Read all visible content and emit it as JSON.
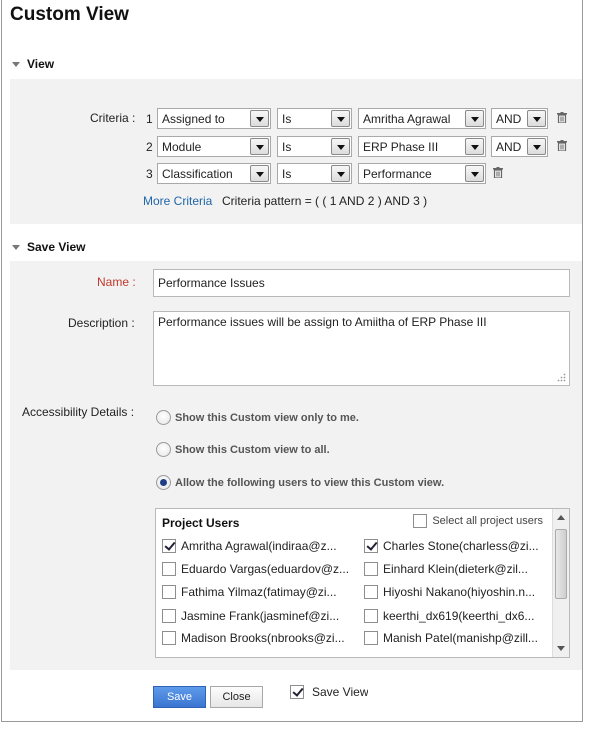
{
  "title": "Custom View",
  "view_section": {
    "heading": "View",
    "criteria_label": "Criteria :",
    "rows": [
      {
        "num": "1",
        "field": "Assigned to",
        "op": "Is",
        "value": "Amritha Agrawal",
        "conj": "AND"
      },
      {
        "num": "2",
        "field": "Module",
        "op": "Is",
        "value": "ERP Phase III",
        "conj": "AND"
      },
      {
        "num": "3",
        "field": "Classification",
        "op": "Is",
        "value": "Performance"
      }
    ],
    "more_criteria": "More Criteria",
    "pattern": "Criteria pattern = ( ( 1 AND 2 ) AND 3 )"
  },
  "save_section": {
    "heading": "Save View",
    "name_label": "Name :",
    "name_value": "Performance Issues",
    "description_label": "Description :",
    "description_value": "Performance issues will be assign to Amiitha of ERP Phase III",
    "access_label": "Accessibility Details :",
    "options": [
      "Show this Custom view only to me.",
      "Show this Custom view to all.",
      "Allow the following users to view this Custom view."
    ],
    "users_heading": "Project Users",
    "select_all": "Select all project users",
    "users": [
      {
        "name": "Amritha Agrawal(indiraa@z...",
        "checked": true
      },
      {
        "name": "Charles Stone(charless@zi...",
        "checked": true
      },
      {
        "name": "Eduardo Vargas(eduardov@z...",
        "checked": false
      },
      {
        "name": "Einhard Klein(dieterk@zil...",
        "checked": false
      },
      {
        "name": "Fathima Yilmaz(fatimay@zi...",
        "checked": false
      },
      {
        "name": "Hiyoshi Nakano(hiyoshin.n...",
        "checked": false
      },
      {
        "name": "Jasmine Frank(jasminef@zi...",
        "checked": false
      },
      {
        "name": "keerthi_dx619(keerthi_dx6...",
        "checked": false
      },
      {
        "name": "Madison Brooks(nbrooks@zi...",
        "checked": false
      },
      {
        "name": "Manish Patel(manishp@zill...",
        "checked": false
      }
    ]
  },
  "footer": {
    "save": "Save",
    "close": "Close",
    "save_view_label": "Save View"
  }
}
